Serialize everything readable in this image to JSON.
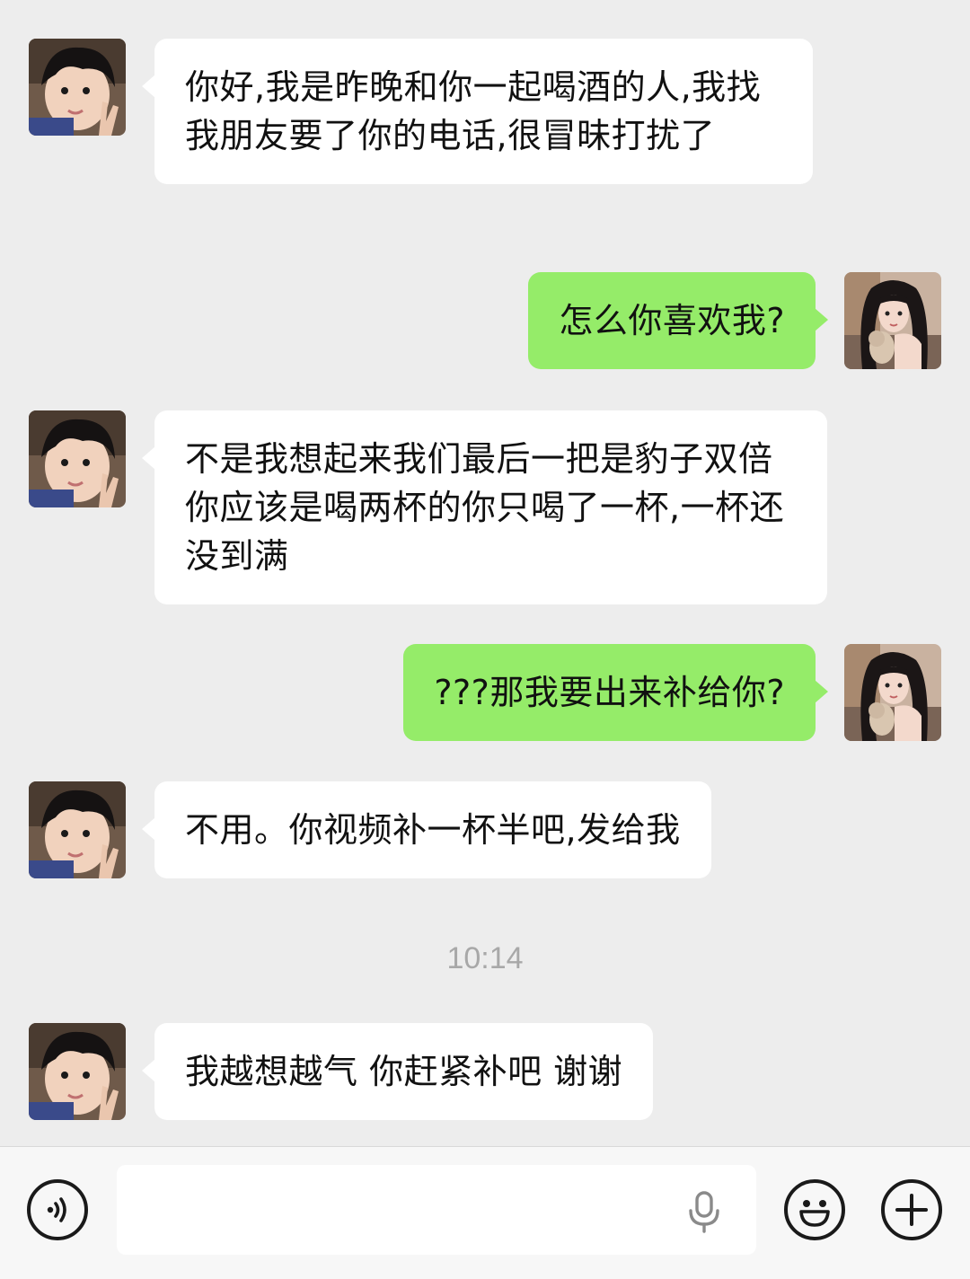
{
  "messages": [
    {
      "sender": "other",
      "text": "你好,我是昨晚和你一起喝酒的人,我找我朋友要了你的电话,很冒昧打扰了"
    },
    {
      "sender": "self",
      "text": "怎么你喜欢我?"
    },
    {
      "sender": "other",
      "text": "不是我想起来我们最后一把是豹子双倍你应该是喝两杯的你只喝了一杯,一杯还没到满"
    },
    {
      "sender": "self",
      "text": "???那我要出来补给你?"
    },
    {
      "sender": "other",
      "text": "不用。你视频补一杯半吧,发给我"
    },
    {
      "sender": "other",
      "text": "我越想越气 你赶紧补吧 谢谢"
    }
  ],
  "timestamp": "10:14",
  "input_bar": {
    "voice_icon": "voice-icon",
    "mic_icon": "mic-icon",
    "emoji_icon": "emoji-icon",
    "plus_icon": "plus-icon",
    "input_value": ""
  },
  "colors": {
    "background": "#ededed",
    "incoming_bubble": "#ffffff",
    "outgoing_bubble": "#95ec69",
    "timestamp_text": "#a8a8a8"
  }
}
